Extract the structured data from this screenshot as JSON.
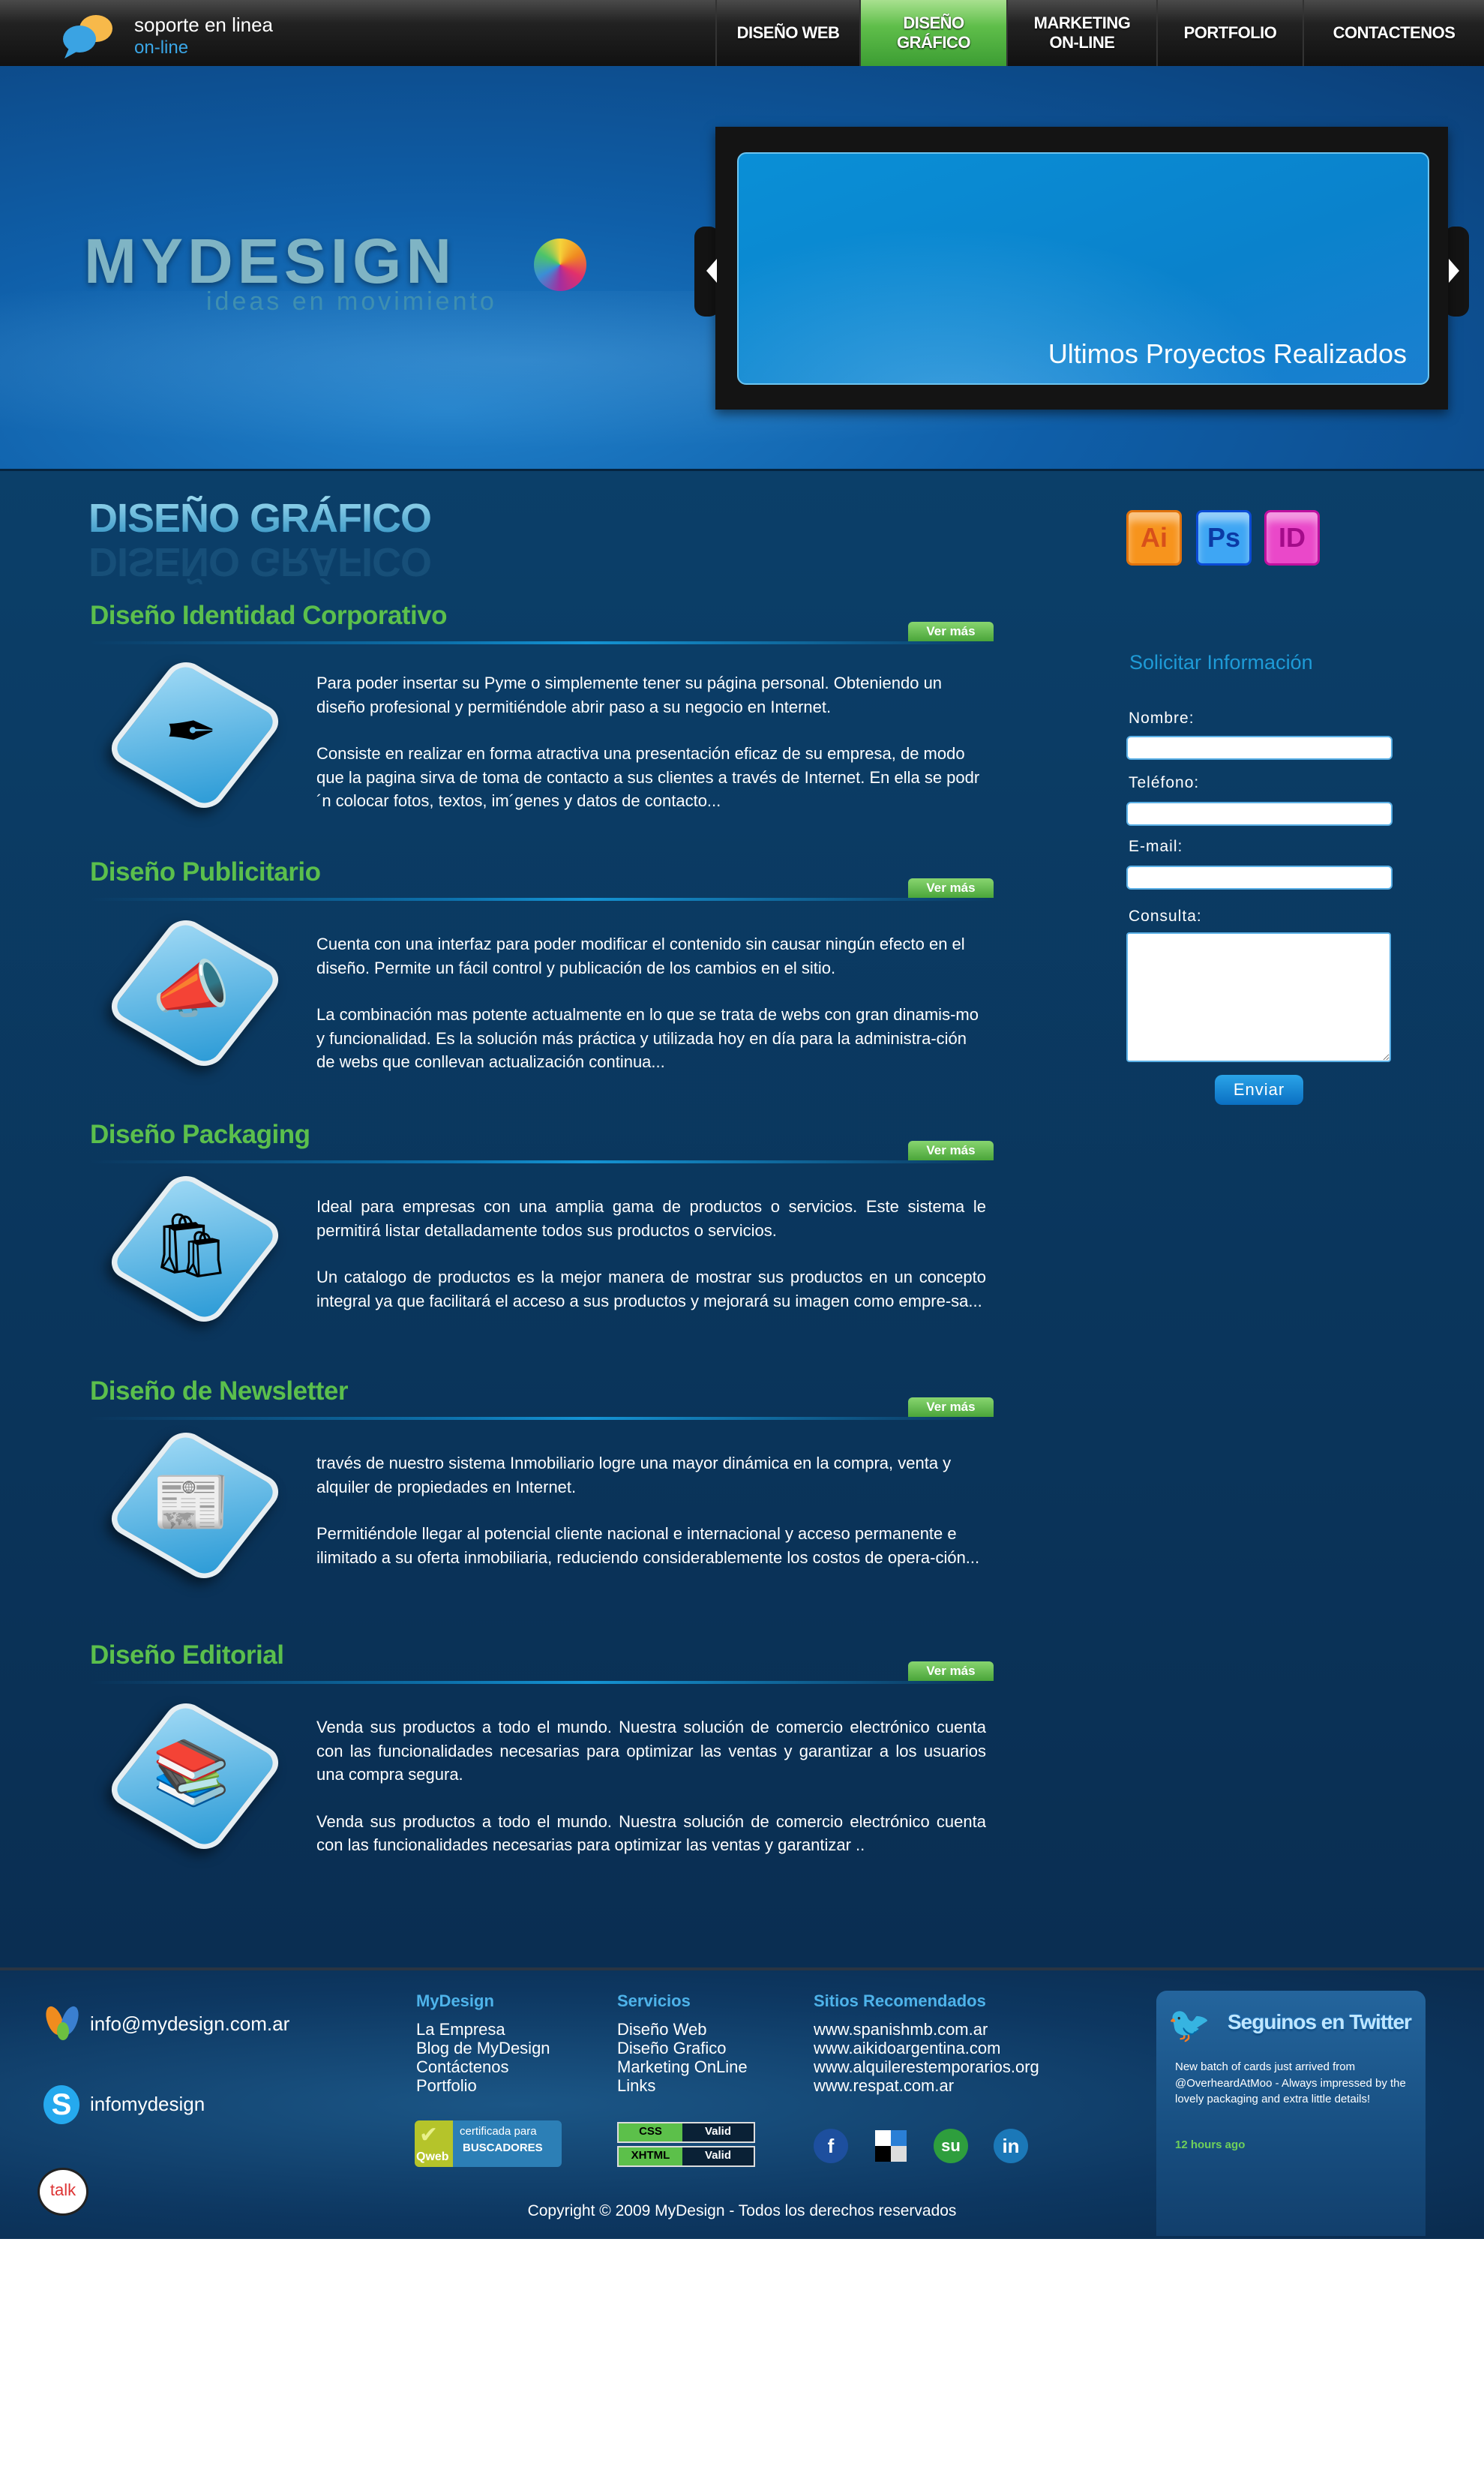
{
  "header": {
    "support_title": "soporte en linea",
    "support_status": "on-line",
    "nav": [
      {
        "label": "DISEÑO WEB",
        "active": false
      },
      {
        "label": "DISEÑO GRÁFICO",
        "active": true
      },
      {
        "label": "MARKETING ON-LINE",
        "active": false
      },
      {
        "label": "PORTFOLIO",
        "active": false
      },
      {
        "label": "CONTACTENOS",
        "active": false
      }
    ],
    "active_color": "#4fb040"
  },
  "hero": {
    "logo": "MYDESIGN",
    "tagline": "ideas en movimiento",
    "slider_caption": "Ultimos Proyectos Realizados"
  },
  "main": {
    "page_title": "DISEÑO GRÁFICO",
    "app_icons": [
      "Ai",
      "Ps",
      "ID"
    ],
    "more_label": "Ver más",
    "sections": [
      {
        "title": "Diseño Identidad Corporativo",
        "icon": "pen-signature-icon",
        "glyph": "✒",
        "paragraphs": [
          "Para poder insertar su Pyme o simplemente tener su página personal. Obteniendo un diseño profesional y permitiéndole abrir paso a su negocio en Internet.",
          "Consiste en realizar en forma atractiva una presentación eficaz de su empresa, de modo que la pagina sirva de toma de contacto a sus clientes a través de Internet. En ella se podr´n colocar fotos, textos, im´genes y datos de contacto..."
        ]
      },
      {
        "title": "Diseño Publicitario",
        "icon": "megaphone-icon",
        "glyph": "📣",
        "paragraphs": [
          "Cuenta con una interfaz para poder modificar el contenido sin causar ningún efecto en el diseño. Permite un fácil control y publicación de los cambios en el sitio.",
          "La combinación mas potente actualmente en lo que se trata de webs con gran dinamis-mo y funcionalidad. Es la solución más práctica y utilizada hoy en día para la administra-ción de webs que conllevan actualización continua..."
        ]
      },
      {
        "title": "Diseño Packaging",
        "icon": "shopping-bag-icon",
        "glyph": "🛍",
        "paragraphs": [
          "Ideal para empresas con una amplia gama de productos o servicios. Este sistema le permitirá listar detalladamente todos sus productos o servicios.",
          "Un catalogo de productos es la mejor manera de mostrar sus productos en un concepto integral ya que facilitará el acceso a sus productos y mejorará su imagen como empre-sa..."
        ]
      },
      {
        "title": "Diseño de Newsletter",
        "icon": "newsletter-icon",
        "glyph": "📰",
        "paragraphs": [
          " través de nuestro sistema Inmobiliario logre una mayor dinámica en la compra, venta y alquiler de propiedades en Internet.",
          "Permitiéndole llegar al potencial cliente nacional e internacional y acceso permanente e ilimitado a su oferta inmobiliaria, reduciendo considerablemente los costos de opera-ción..."
        ]
      },
      {
        "title": "Diseño Editorial",
        "icon": "books-icon",
        "glyph": "📚",
        "paragraphs": [
          "Venda sus productos a todo el mundo. Nuestra solución de comercio electrónico cuenta con las funcionalidades necesarias para optimizar las ventas y garantizar a los usuarios una compra segura.",
          "Venda sus productos a todo el mundo. Nuestra solución de comercio electrónico cuenta con las funcionalidades necesarias para optimizar las ventas y garantizar .."
        ]
      }
    ]
  },
  "form": {
    "title": "Solicitar Información",
    "nombre_label": "Nombre:",
    "nombre_value": "",
    "telefono_label": "Teléfono:",
    "telefono_value": "",
    "email_label": "E-mail:",
    "email_value": "",
    "consulta_label": "Consulta:",
    "consulta_value": "",
    "submit": "Enviar"
  },
  "footer": {
    "email": "info@mydesign.com.ar",
    "skype": "infomydesign",
    "talk_label": "talk",
    "columns": [
      {
        "heading": "MyDesign",
        "links": [
          "La Empresa",
          "Blog de MyDesign",
          "Contáctenos",
          "Portfolio"
        ]
      },
      {
        "heading": "Servicios",
        "links": [
          "Diseño Web",
          "Diseño Grafico",
          "Marketing OnLine",
          "Links"
        ]
      },
      {
        "heading": "Sitios Recomendados",
        "links": [
          "www.spanishmb.com.ar",
          "www.aikidoargentina.com",
          "www.alquilerestemporarios.org",
          "www.respat.com.ar"
        ]
      }
    ],
    "qweb_badge": {
      "line1": "certificada para",
      "line2": "BUSCADORES",
      "brand": "Qweb"
    },
    "valid_badges": [
      {
        "key": "CSS",
        "value": "Valid"
      },
      {
        "key": "XHTML",
        "value": "Valid"
      }
    ],
    "social": [
      {
        "icon": "facebook-icon",
        "glyph": "f",
        "color": "#1d4f9e"
      },
      {
        "icon": "delicious-icon",
        "glyph": "",
        "color": "#ffffff"
      },
      {
        "icon": "stumbleupon-icon",
        "glyph": "su",
        "color": "#2e9e3d"
      },
      {
        "icon": "linkedin-icon",
        "glyph": "in",
        "color": "#1b78b8"
      }
    ],
    "copyright": "Copyright © 2009 MyDesign - Todos los derechos reservados",
    "twitter": {
      "title": "Seguinos en Twitter",
      "tweet": "New batch of cards just arrived from @OverheardAtMoo - Always impressed by the lovely packaging and extra little details!",
      "time": "12 hours ago"
    }
  }
}
